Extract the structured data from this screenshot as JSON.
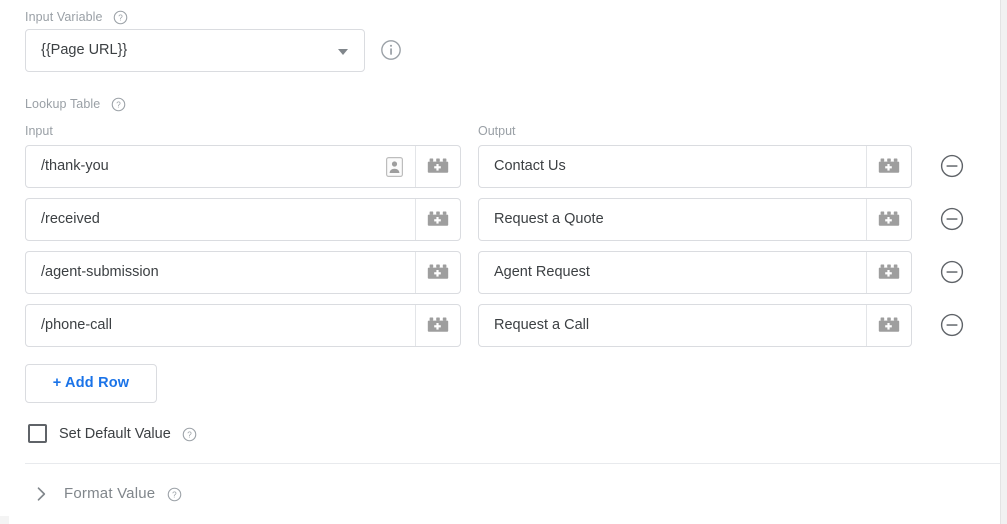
{
  "input_variable": {
    "label": "Input Variable",
    "help_icon": "help-circle-icon",
    "value": "{{Page URL}}",
    "caret_icon": "chevron-down-icon",
    "info_icon": "info-circle-icon"
  },
  "lookup_table": {
    "label": "Lookup Table",
    "help_icon": "help-circle-icon",
    "columns": {
      "input": "Input",
      "output": "Output"
    },
    "variable_picker_icon": "lego-brick-plus-icon",
    "autofill_icon": "autofill-icon",
    "remove_row_icon": "minus-circle-icon",
    "rows": [
      {
        "input": "/thank-you",
        "output": "Contact Us",
        "has_autofill": true
      },
      {
        "input": "/received",
        "output": "Request a Quote",
        "has_autofill": false
      },
      {
        "input": "/agent-submission",
        "output": "Agent Request",
        "has_autofill": false
      },
      {
        "input": "/phone-call",
        "output": "Request a Call",
        "has_autofill": false
      }
    ]
  },
  "add_row": {
    "label": "+ Add Row"
  },
  "default_value": {
    "label": "Set Default Value",
    "checked": false,
    "help_icon": "help-circle-icon"
  },
  "format_value": {
    "label": "Format Value",
    "expanded": false,
    "chevron_icon": "chevron-right-icon",
    "help_icon": "help-circle-icon"
  },
  "colors": {
    "accent": "#1a73e8",
    "label_text": "#9aa0a6",
    "body_text": "#3c4043",
    "border": "#dadce0",
    "icon_gray": "#9e9e9e"
  }
}
